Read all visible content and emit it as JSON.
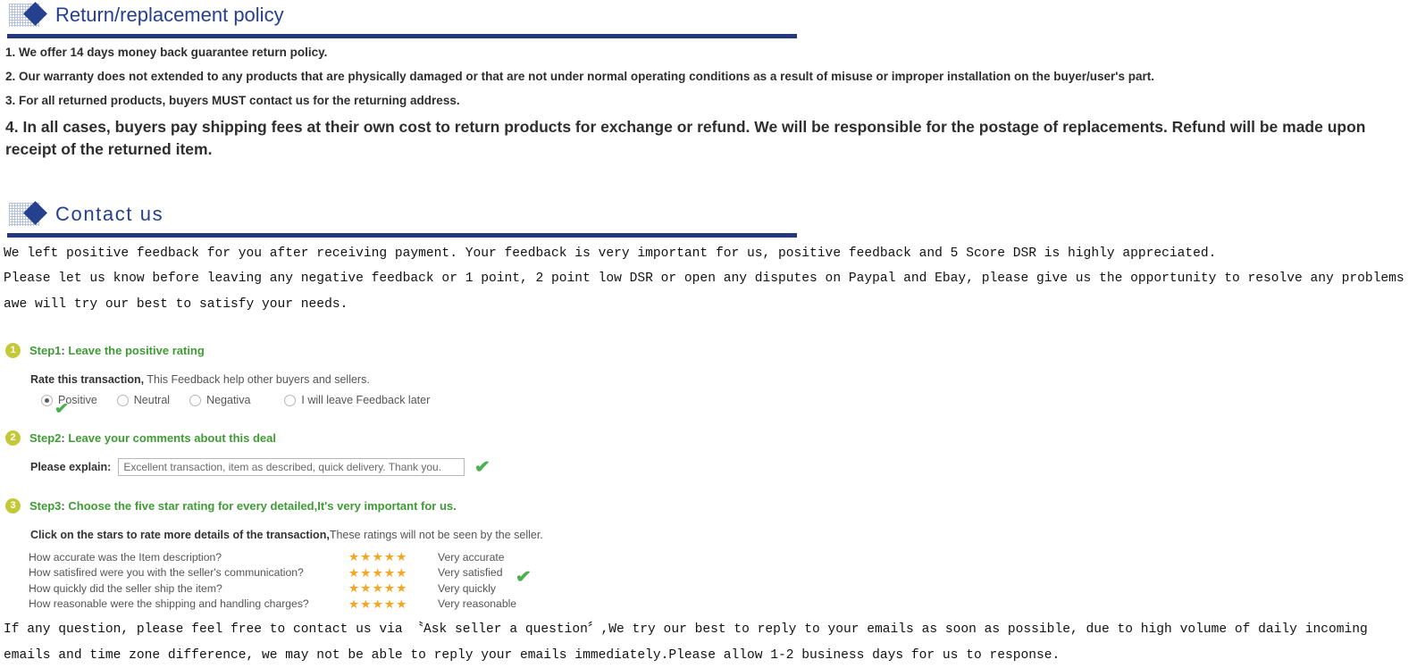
{
  "sections": {
    "policy": {
      "title": "Return/replacement policy",
      "icon": "diamond-halftone-icon",
      "items": [
        "1. We offer 14 days money back guarantee return policy.",
        "2. Our warranty does not extended to any products that are physically damaged or that are not under normal operating conditions as a result of misuse or improper installation on the buyer/user's part.",
        "3. For all returned products, buyers MUST contact us for the returning address.",
        "4. In all cases, buyers pay shipping fees at their own cost to return products for exchange or refund. We will be responsible for the postage of replacements. Refund will be made upon receipt of the returned item."
      ]
    },
    "contact": {
      "title": "Contact us",
      "icon": "diamond-halftone-icon",
      "intro": [
        "We left positive feedback for you after receiving payment. Your feedback is very important for us, positive feedback and 5 Score DSR is highly appreciated.",
        "Please let us know before leaving any negative feedback or 1 point, 2 point low DSR or open any disputes on Paypal and Ebay, please give us the opportunity to resolve any problems awe will try our best to satisfy your needs."
      ],
      "outro": "If any question, please feel free to contact us via 〝Ask seller a question〞,We try our best to reply to your emails as soon as possible, due to high volume of daily incoming emails and time zone difference, we may not be able to reply your emails immediately.Please allow 1-2 business days for us to response."
    }
  },
  "steps": [
    {
      "badge": "1",
      "prefix": "Step1",
      "separator": ":",
      "title": "Leave the positive rating",
      "sub_strong": "Rate this transaction,",
      "sub_normal": "This Feedback help other buyers and sellers."
    },
    {
      "badge": "2",
      "prefix": "Step2",
      "separator": ":",
      "title": "Leave your comments about this deal"
    },
    {
      "badge": "3",
      "prefix": "Step3",
      "separator": ":",
      "title": "Choose the five star rating for every detailed,It's very important for us.",
      "sub_strong": "Click on the stars to rate more details of the transaction,",
      "sub_normal": "These ratings will not be seen by the seller."
    }
  ],
  "rating_options": [
    {
      "label": "Positive",
      "selected": true
    },
    {
      "label": "Neutral",
      "selected": false
    },
    {
      "label": "Negativa",
      "selected": false
    },
    {
      "label": "I will leave Feedback later",
      "selected": false
    }
  ],
  "comment": {
    "label": "Please explain:",
    "value": "Excellent transaction, item as described, quick delivery. Thank you."
  },
  "detailed_ratings": [
    {
      "question": "How accurate was the Item description?",
      "stars": "★★★★★",
      "value": "Very accurate"
    },
    {
      "question": "How satisfired were you with the seller's communication?",
      "stars": "★★★★★",
      "value": "Very satisfied"
    },
    {
      "question": "How quickly did the seller ship the item?",
      "stars": "★★★★★",
      "value": "Very quickly"
    },
    {
      "question": "How reasonable were the shipping and handling charges?",
      "stars": "★★★★★",
      "value": "Very reasonable"
    }
  ],
  "icons": {
    "check": "✔"
  },
  "colors": {
    "header_blue": "#24408e",
    "rule_blue": "#23387d",
    "step_green": "#3f9c35",
    "badge_olive": "#c3c939",
    "star_orange": "#f5a623",
    "check_green": "#4caf50"
  }
}
